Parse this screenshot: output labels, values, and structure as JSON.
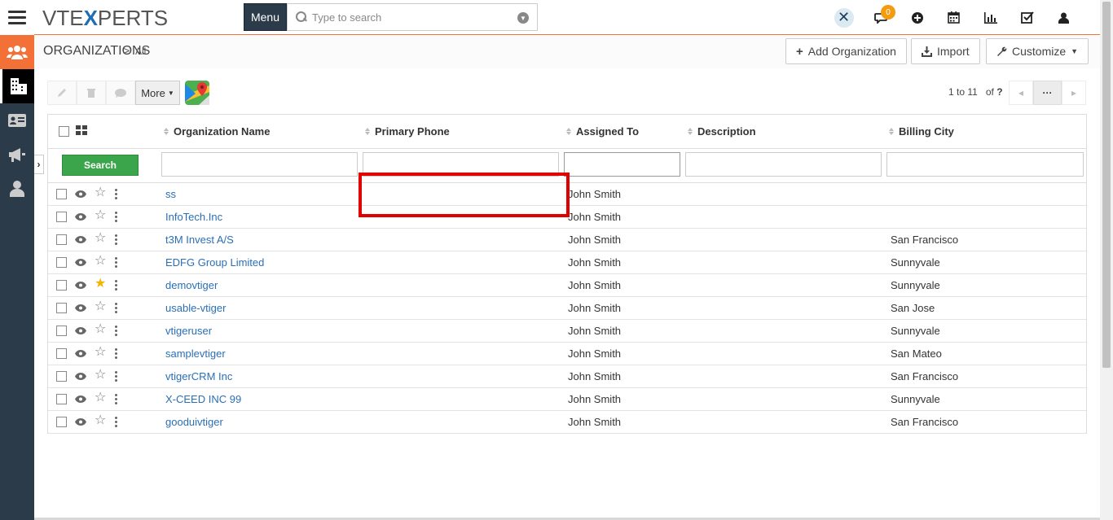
{
  "app": {
    "logo_pre": "VTE",
    "logo_x": "X",
    "logo_post": "PERTS"
  },
  "header": {
    "menu_label": "Menu",
    "search_placeholder": "Type to search",
    "notification_count": "0"
  },
  "breadcrumb": {
    "module": "ORGANIZATIONS",
    "separator": ">",
    "view": "All"
  },
  "actions": {
    "add_label": "Add Organization",
    "import_label": "Import",
    "customize_label": "Customize"
  },
  "toolbar": {
    "more_label": "More"
  },
  "pager": {
    "range": "1 to 11",
    "of_label": "of",
    "total": "?",
    "dots": "···"
  },
  "table": {
    "columns": [
      "Organization Name",
      "Primary Phone",
      "Assigned To",
      "Description",
      "Billing City"
    ],
    "search_label": "Search",
    "rows": [
      {
        "name": "ss",
        "phone": "",
        "assigned": "John Smith",
        "desc": "",
        "city": "",
        "starred": false
      },
      {
        "name": "InfoTech.Inc",
        "phone": "",
        "assigned": "John Smith",
        "desc": "",
        "city": "",
        "starred": false
      },
      {
        "name": "t3M Invest A/S",
        "phone": "",
        "assigned": "John Smith",
        "desc": "",
        "city": "San Francisco",
        "starred": false
      },
      {
        "name": "EDFG Group Limited",
        "phone": "",
        "assigned": "John Smith",
        "desc": "",
        "city": "Sunnyvale",
        "starred": false
      },
      {
        "name": "demovtiger",
        "phone": "",
        "assigned": "John Smith",
        "desc": "",
        "city": "Sunnyvale",
        "starred": true
      },
      {
        "name": "usable-vtiger",
        "phone": "",
        "assigned": "John Smith",
        "desc": "",
        "city": "San Jose",
        "starred": false
      },
      {
        "name": "vtigeruser",
        "phone": "",
        "assigned": "John Smith",
        "desc": "",
        "city": "Sunnyvale",
        "starred": false
      },
      {
        "name": "samplevtiger",
        "phone": "",
        "assigned": "John Smith",
        "desc": "",
        "city": "San Mateo",
        "starred": false
      },
      {
        "name": "vtigerCRM Inc",
        "phone": "",
        "assigned": "John Smith",
        "desc": "",
        "city": "San Francisco",
        "starred": false
      },
      {
        "name": "X-CEED INC 99",
        "phone": "",
        "assigned": "John Smith",
        "desc": "",
        "city": "Sunnyvale",
        "starred": false
      },
      {
        "name": "gooduivtiger",
        "phone": "",
        "assigned": "John Smith",
        "desc": "",
        "city": "San Francisco",
        "starred": false
      }
    ]
  },
  "colors": {
    "accent": "#f37037",
    "sidebar": "#2c3b49",
    "link": "#2a6fb5",
    "search_green": "#3aa54a",
    "highlight_red": "#e00000",
    "star": "#f5b400"
  }
}
